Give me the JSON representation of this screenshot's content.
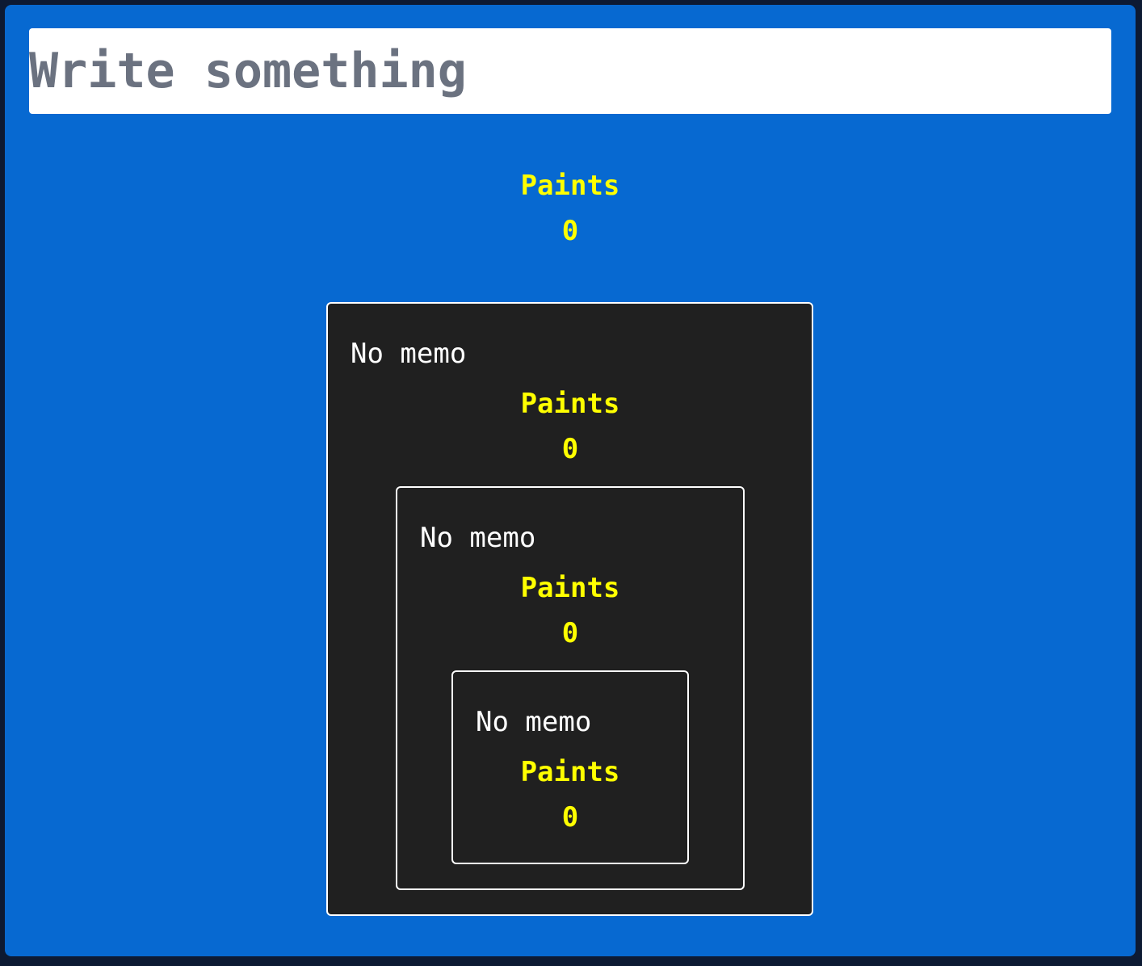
{
  "input": {
    "placeholder": "Write something",
    "value": ""
  },
  "root_counter": {
    "label": "Paints",
    "count": "0"
  },
  "boxes": [
    {
      "label": "No memo",
      "counter_label": "Paints",
      "count": "0"
    },
    {
      "label": "No memo",
      "counter_label": "Paints",
      "count": "0"
    },
    {
      "label": "No memo",
      "counter_label": "Paints",
      "count": "0"
    }
  ],
  "colors": {
    "background": "#0769d1",
    "page": "#0d1a33",
    "box": "#202020",
    "border": "#ffffff",
    "counter": "#ffff00",
    "placeholder": "#6b7280"
  }
}
